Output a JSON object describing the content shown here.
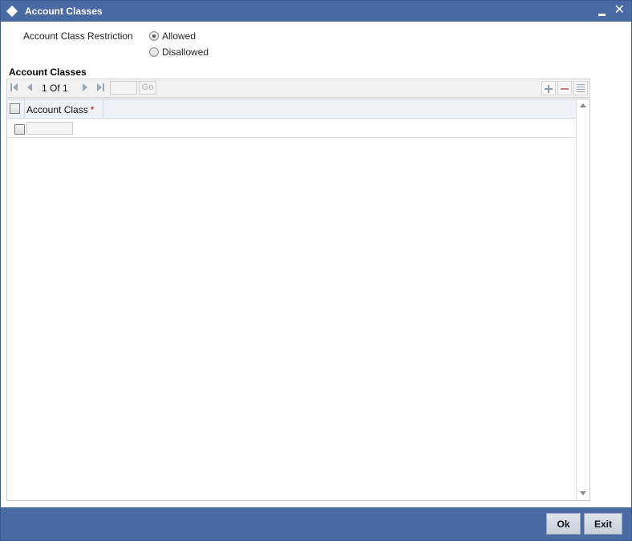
{
  "window": {
    "title": "Account Classes"
  },
  "restriction": {
    "label": "Account Class Restriction",
    "options": [
      {
        "label": "Allowed",
        "selected": true
      },
      {
        "label": "Disallowed",
        "selected": false
      }
    ]
  },
  "section": {
    "heading": "Account Classes"
  },
  "pagination": {
    "page_info": "1 Of 1",
    "page_input_value": "",
    "go_label": "Go"
  },
  "grid": {
    "column_header": "Account Class",
    "required_marker": "*",
    "rows": [
      {
        "account_class": ""
      }
    ]
  },
  "footer": {
    "ok_label": "Ok",
    "exit_label": "Exit"
  },
  "colors": {
    "titlebar": "#4a6aa3",
    "footer": "#4a6aa3",
    "required": "#c00000"
  }
}
